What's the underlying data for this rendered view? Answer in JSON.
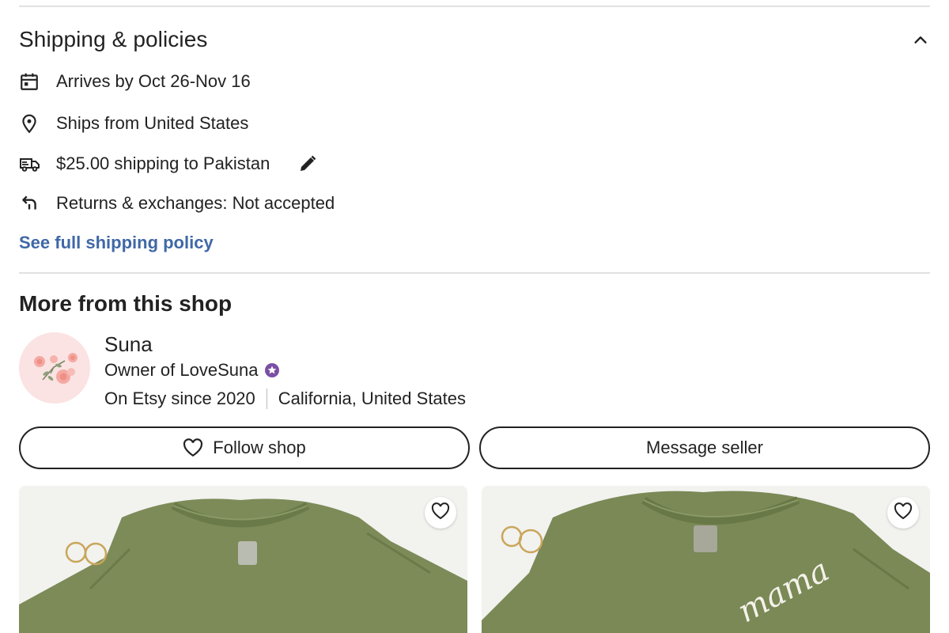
{
  "shipping": {
    "title": "Shipping & policies",
    "arrival": "Arrives by Oct 26-Nov 16",
    "ships_from": "Ships from United States",
    "shipping_cost": "$25.00 shipping to Pakistan",
    "returns": "Returns & exchanges: Not accepted",
    "policy_link": "See full shipping policy"
  },
  "shop": {
    "section_title": "More from this shop",
    "owner_name": "Suna",
    "owner_role": "Owner of LoveSuna",
    "since": "On Etsy since 2020",
    "location": "California, United States",
    "follow_label": "Follow shop",
    "message_label": "Message seller"
  },
  "products": [
    {
      "favorite_icon": "heart-outline-icon"
    },
    {
      "favorite_icon": "heart-outline-icon",
      "print_text": "mama"
    }
  ],
  "colors": {
    "link": "#3f68a6",
    "star_seller": "#7b4fa4",
    "sweatshirt": "#7a8a57",
    "background": "#ffffff"
  }
}
